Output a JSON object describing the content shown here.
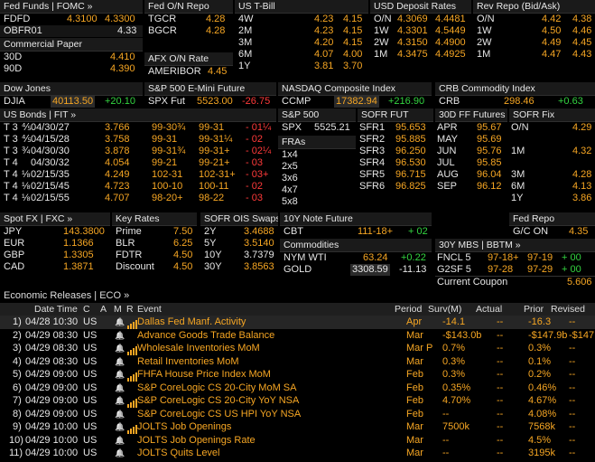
{
  "colors": {
    "orange": "#f6a623",
    "green": "#33d440",
    "red": "#ff3a3a",
    "white": "#e6e6e6"
  },
  "fed_funds": {
    "header": "Fed Funds | FOMC »",
    "rows": [
      {
        "label": "FDFD",
        "v1": "4.3100",
        "v2": "4.3300"
      },
      {
        "label": "OBFR01",
        "v1": "",
        "v2": "4.33"
      }
    ]
  },
  "fed_on_repo": {
    "header": "Fed O/N Repo",
    "rows": [
      {
        "label": "TGCR",
        "v": "4.28"
      },
      {
        "label": "BGCR",
        "v": "4.28"
      }
    ]
  },
  "us_tbill": {
    "header": "US T-Bill",
    "rows": [
      {
        "label": "4W",
        "v1": "4.23",
        "v2": "4.15"
      },
      {
        "label": "2M",
        "v1": "4.23",
        "v2": "4.15"
      },
      {
        "label": "3M",
        "v1": "4.20",
        "v2": "4.15"
      },
      {
        "label": "6M",
        "v1": "4.07",
        "v2": "4.00"
      },
      {
        "label": "1Y",
        "v1": "3.81",
        "v2": "3.70"
      }
    ]
  },
  "usd_deposit": {
    "header": "USD Deposit Rates",
    "rows": [
      {
        "label": "O/N",
        "v1": "4.3069",
        "v2": "4.4481"
      },
      {
        "label": "1W",
        "v1": "4.3301",
        "v2": "4.5449"
      },
      {
        "label": "2W",
        "v1": "4.3150",
        "v2": "4.4900"
      },
      {
        "label": "1M",
        "v1": "4.3475",
        "v2": "4.4925"
      }
    ]
  },
  "rev_repo": {
    "header": "Rev Repo (Bid/Ask)",
    "rows": [
      {
        "label": "O/N",
        "v1": "4.42",
        "v2": "4.38"
      },
      {
        "label": "1W",
        "v1": "4.50",
        "v2": "4.46"
      },
      {
        "label": "2W",
        "v1": "4.49",
        "v2": "4.45"
      },
      {
        "label": "1M",
        "v1": "4.47",
        "v2": "4.43"
      }
    ]
  },
  "commercial_paper": {
    "header": "Commercial Paper",
    "rows": [
      {
        "label": "30D",
        "v": "4.410"
      },
      {
        "label": "90D",
        "v": "4.390"
      }
    ]
  },
  "afx_on": {
    "header": "AFX O/N Rate",
    "rows": [
      {
        "label": "AMERIBOR",
        "v": "4.45"
      }
    ]
  },
  "dow": {
    "header": "Dow Jones",
    "label": "DJIA",
    "value": "40113.50",
    "chg": "+20.10"
  },
  "sp_emini": {
    "header": "S&P 500 E-Mini Future",
    "label": "SPX Fut",
    "value": "5523.00",
    "chg": "-26.75"
  },
  "nasdaq": {
    "header": "NASDAQ Composite Index",
    "label": "CCMP",
    "value": "17382.94",
    "chg": "+216.90"
  },
  "crb": {
    "header": "CRB Commodity Index",
    "label": "CRB",
    "value": "298.46",
    "chg": "+0.63"
  },
  "us_bonds": {
    "header": "US Bonds | FIT »",
    "rows": [
      {
        "name": "T 3",
        "frac": "⅘",
        "date": "04/30/27",
        "yld": "3.766",
        "bid": "99-30¾",
        "ask": "99-31",
        "chg": "- 01¼"
      },
      {
        "name": "T 3",
        "frac": "⅘",
        "date": "04/15/28",
        "yld": "3.758",
        "bid": "99-31",
        "ask": "99-31¼",
        "chg": "- 02"
      },
      {
        "name": "T 3",
        "frac": "¾",
        "date": "04/30/30",
        "yld": "3.878",
        "bid": "99-31¾",
        "ask": "99-31+",
        "chg": "- 02¼"
      },
      {
        "name": "T 4",
        "frac": "",
        "date": "04/30/32",
        "yld": "4.054",
        "bid": "99-21",
        "ask": "99-21+",
        "chg": "- 03"
      },
      {
        "name": "T 4",
        "frac": "⅛",
        "date": "02/15/35",
        "yld": "4.249",
        "bid": "102-31",
        "ask": "102-31+",
        "chg": "- 03+"
      },
      {
        "name": "T 4",
        "frac": "⅛",
        "date": "02/15/45",
        "yld": "4.723",
        "bid": "100-10",
        "ask": "100-11",
        "chg": "- 02"
      },
      {
        "name": "T 4",
        "frac": "⅛",
        "date": "02/15/55",
        "yld": "4.707",
        "bid": "98-20+",
        "ask": "98-22",
        "chg": "- 03"
      }
    ]
  },
  "sp500": {
    "header": "S&P 500",
    "label": "SPX",
    "value": "5525.21"
  },
  "fras": {
    "header": "FRAs",
    "rows": [
      "1x4",
      "2x5",
      "3x6",
      "4x7",
      "5x8"
    ]
  },
  "sofr_fut": {
    "header": "SOFR FUT",
    "rows": [
      {
        "label": "SFR1",
        "v": "95.653"
      },
      {
        "label": "SFR2",
        "v": "95.885"
      },
      {
        "label": "SFR3",
        "v": "96.250"
      },
      {
        "label": "SFR4",
        "v": "96.530"
      },
      {
        "label": "SFR5",
        "v": "96.715"
      },
      {
        "label": "SFR6",
        "v": "96.825"
      }
    ]
  },
  "ff_futures": {
    "header": "30D FF Futures",
    "rows": [
      {
        "label": "APR",
        "v": "95.67"
      },
      {
        "label": "MAY",
        "v": "95.69"
      },
      {
        "label": "JUN",
        "v": "95.76"
      },
      {
        "label": "JUL",
        "v": "95.85"
      },
      {
        "label": "AUG",
        "v": "96.04"
      },
      {
        "label": "SEP",
        "v": "96.12"
      }
    ]
  },
  "sofr_fix": {
    "header": "SOFR Fix",
    "rows": [
      {
        "label": "O/N",
        "v": "4.29"
      },
      {
        "label": "",
        "v": ""
      },
      {
        "label": "1M",
        "v": "4.32"
      },
      {
        "label": "",
        "v": ""
      },
      {
        "label": "3M",
        "v": "4.28"
      },
      {
        "label": "6M",
        "v": "4.13"
      },
      {
        "label": "1Y",
        "v": "3.86"
      }
    ]
  },
  "fed_repo": {
    "header": "Fed Repo",
    "label": "G/C ON",
    "v": "4.35"
  },
  "spot_fx": {
    "header": "Spot FX | FXC »",
    "rows": [
      {
        "label": "JPY",
        "v": "143.3800"
      },
      {
        "label": "EUR",
        "v": "1.1366"
      },
      {
        "label": "GBP",
        "v": "1.3305"
      },
      {
        "label": "CAD",
        "v": "1.3871"
      }
    ]
  },
  "key_rates": {
    "header": "Key Rates",
    "rows": [
      {
        "label": "Prime",
        "v": "7.50"
      },
      {
        "label": "BLR",
        "v": "6.25"
      },
      {
        "label": "FDTR",
        "v": "4.50"
      },
      {
        "label": "Discount",
        "v": "4.50"
      }
    ]
  },
  "sofr_ois": {
    "header": "SOFR OIS Swaps",
    "rows": [
      {
        "label": "2Y",
        "v": "3.4688"
      },
      {
        "label": "5Y",
        "v": "3.5140"
      },
      {
        "label": "10Y",
        "v": "3.7379"
      },
      {
        "label": "30Y",
        "v": "3.8563"
      }
    ]
  },
  "note_future": {
    "header": "10Y Note Future",
    "label": "CBT",
    "value": "111-18+",
    "chg": "+ 02"
  },
  "commodities": {
    "header": "Commodities",
    "rows": [
      {
        "label": "NYM WTI",
        "v": "63.24",
        "chg": "+0.22"
      },
      {
        "label": "GOLD",
        "v": "3308.59",
        "chg": "-11.13"
      }
    ]
  },
  "mbs": {
    "header": "30Y MBS | BBTM »",
    "rows": [
      {
        "label": "FNCL 5",
        "bid": "97-18+",
        "ask": "97-19",
        "chg": "+ 00"
      },
      {
        "label": "G2SF 5",
        "bid": "97-28",
        "ask": "97-29",
        "chg": "+ 00"
      }
    ],
    "coupon_label": "Current Coupon",
    "coupon_value": "5.606"
  },
  "economic_releases": {
    "title": "Economic Releases",
    "title_link": "ECO »",
    "columns": [
      "Date Time",
      "C",
      "A",
      "M",
      "R",
      "Event",
      "Period",
      "Surv(M)",
      "Actual",
      "Prior",
      "Revised"
    ],
    "rows": [
      {
        "n": "1)",
        "dt": "04/28 10:30",
        "c": "US",
        "event": "Dallas Fed Manf. Activity",
        "period": "Apr",
        "surv": "-14.1",
        "actual": "--",
        "prior": "-16.3",
        "revised": "--",
        "bars": true,
        "hl": true
      },
      {
        "n": "2)",
        "dt": "04/29 08:30",
        "c": "US",
        "event": "Advance Goods Trade Balance",
        "period": "Mar",
        "surv": "-$143.0b",
        "actual": "--",
        "prior": "-$147.9b",
        "revised": "-$147.8b",
        "bars": false,
        "hl": false
      },
      {
        "n": "3)",
        "dt": "04/29 08:30",
        "c": "US",
        "event": "Wholesale Inventories MoM",
        "period": "Mar P",
        "surv": "0.7%",
        "actual": "--",
        "prior": "0.3%",
        "revised": "--",
        "bars": true,
        "hl": false
      },
      {
        "n": "4)",
        "dt": "04/29 08:30",
        "c": "US",
        "event": "Retail Inventories MoM",
        "period": "Mar",
        "surv": "0.3%",
        "actual": "--",
        "prior": "0.1%",
        "revised": "--",
        "bars": false,
        "hl": false
      },
      {
        "n": "5)",
        "dt": "04/29 09:00",
        "c": "US",
        "event": "FHFA House Price Index MoM",
        "period": "Feb",
        "surv": "0.3%",
        "actual": "--",
        "prior": "0.2%",
        "revised": "--",
        "bars": true,
        "hl": false
      },
      {
        "n": "6)",
        "dt": "04/29 09:00",
        "c": "US",
        "event": "S&P CoreLogic CS 20-City MoM SA",
        "period": "Feb",
        "surv": "0.35%",
        "actual": "--",
        "prior": "0.46%",
        "revised": "--",
        "bars": false,
        "hl": false
      },
      {
        "n": "7)",
        "dt": "04/29 09:00",
        "c": "US",
        "event": "S&P CoreLogic CS 20-City YoY NSA",
        "period": "Feb",
        "surv": "4.70%",
        "actual": "--",
        "prior": "4.67%",
        "revised": "--",
        "bars": true,
        "hl": false
      },
      {
        "n": "8)",
        "dt": "04/29 09:00",
        "c": "US",
        "event": "S&P CoreLogic CS US HPI YoY NSA",
        "period": "Feb",
        "surv": "--",
        "actual": "--",
        "prior": "4.08%",
        "revised": "--",
        "bars": false,
        "hl": false
      },
      {
        "n": "9)",
        "dt": "04/29 10:00",
        "c": "US",
        "event": "JOLTS Job Openings",
        "period": "Mar",
        "surv": "7500k",
        "actual": "--",
        "prior": "7568k",
        "revised": "--",
        "bars": true,
        "hl": false
      },
      {
        "n": "10)",
        "dt": "04/29 10:00",
        "c": "US",
        "event": "JOLTS Job Openings Rate",
        "period": "Mar",
        "surv": "--",
        "actual": "--",
        "prior": "4.5%",
        "revised": "--",
        "bars": false,
        "hl": false
      },
      {
        "n": "11)",
        "dt": "04/29 10:00",
        "c": "US",
        "event": "JOLTS Quits Level",
        "period": "Mar",
        "surv": "--",
        "actual": "--",
        "prior": "3195k",
        "revised": "--",
        "bars": false,
        "hl": false
      }
    ]
  }
}
